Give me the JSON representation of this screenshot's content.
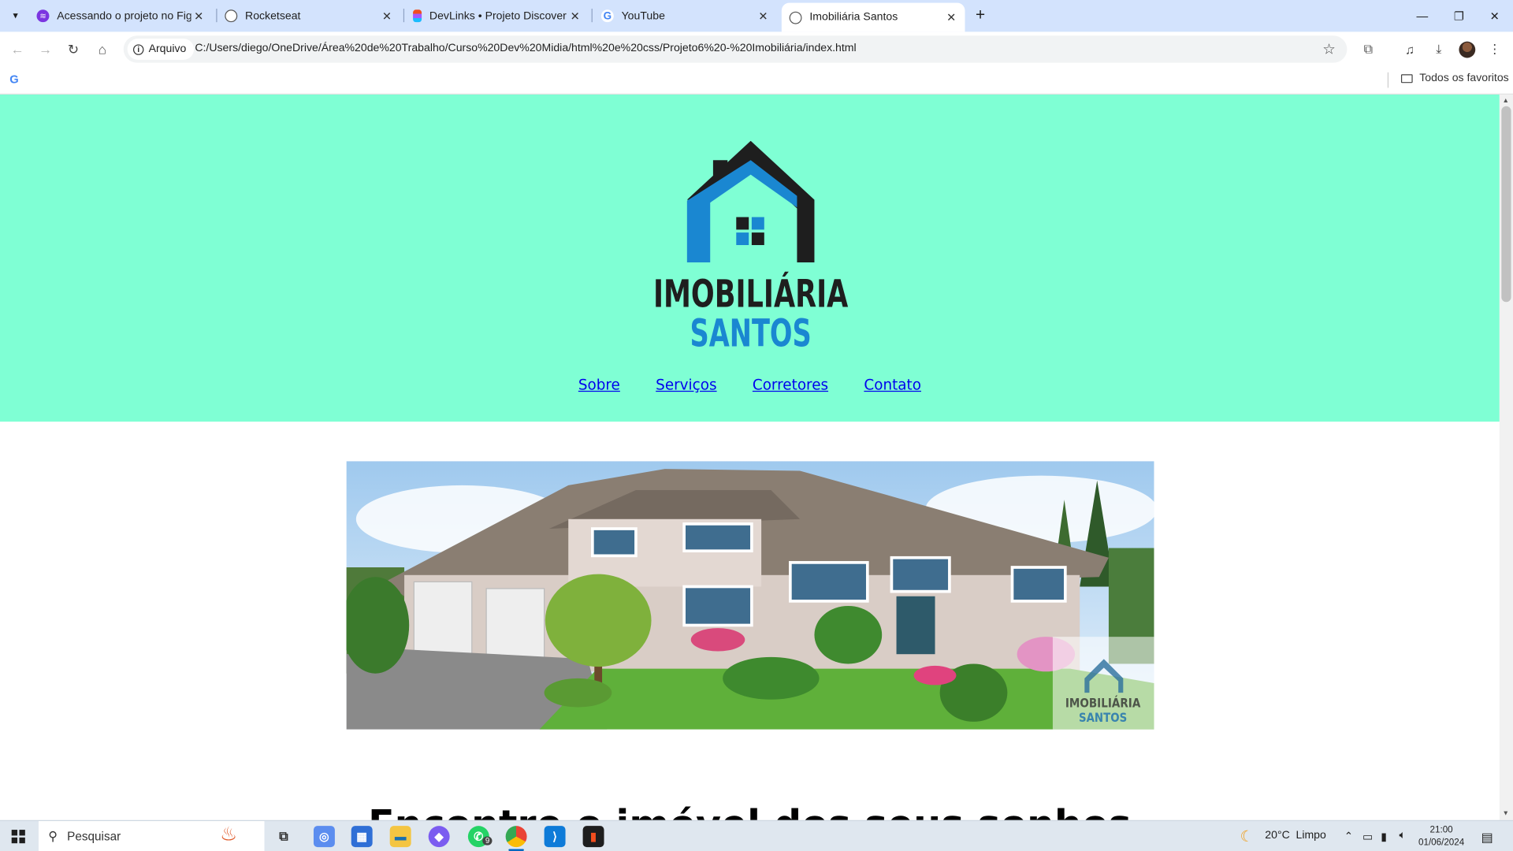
{
  "browser": {
    "tabs": [
      {
        "title": "Acessando o projeto no Figm",
        "favicon": "figma-academy-icon"
      },
      {
        "title": "Rocketseat",
        "favicon": "globe-icon"
      },
      {
        "title": "DevLinks • Projeto Discover (",
        "favicon": "figma-icon"
      },
      {
        "title": "YouTube",
        "favicon": "google-icon"
      },
      {
        "title": "Imobiliária Santos",
        "favicon": "globe-icon",
        "active": true
      }
    ],
    "security_chip": "Arquivo",
    "url": "C:/Users/diego/OneDrive/Área%20de%20Trabalho/Curso%20Dev%20Midia/html%20e%20css/Projeto6%20-%20Imobiliária/index.html",
    "bookmarks_all": "Todos os favoritos"
  },
  "page": {
    "logo_line1": "IMOBILIÁRIA",
    "logo_line2": "SANTOS",
    "nav": [
      "Sobre",
      "Serviços",
      "Corretores",
      "Contato"
    ],
    "watermark_line1": "IMOBILIÁRIA",
    "watermark_line2": "SANTOS",
    "heading_partial": "Encontre o imóvel dos seus sonhos",
    "colors": {
      "header_bg": "#7fffd4",
      "logo_dark": "#1e1e1e",
      "logo_blue": "#1a87d1",
      "link": "#0000ee"
    }
  },
  "taskbar": {
    "search_placeholder": "Pesquisar",
    "whatsapp_badge": "9",
    "weather_temp": "20°C",
    "weather_desc": "Limpo",
    "time": "21:00",
    "date": "01/06/2024"
  }
}
